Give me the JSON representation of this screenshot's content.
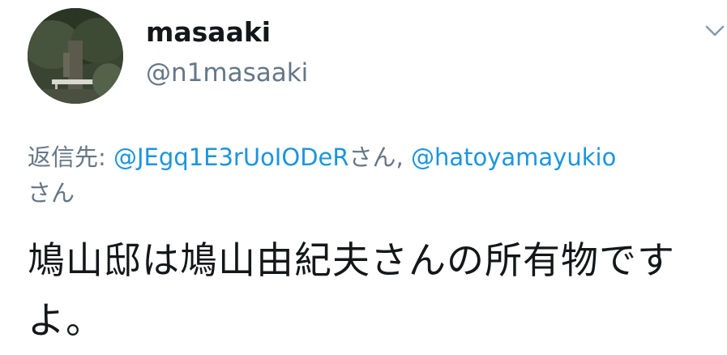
{
  "author": {
    "display_name": "masaaki",
    "handle": "@n1masaaki"
  },
  "reply": {
    "prefix": "返信先: ",
    "mention1": "@JEgq1E3rUoIODeR",
    "suffix1": "さん, ",
    "mention2": "@hatoyamayukio",
    "suffix2": "さん"
  },
  "tweet": {
    "text": "鳩山邸は鳩山由紀夫さんの所有物ですよ。"
  },
  "colors": {
    "mention": "#1b95e0",
    "secondary": "#657786",
    "primary": "#14171a"
  },
  "icons": {
    "caret": "chevron-down-icon"
  }
}
